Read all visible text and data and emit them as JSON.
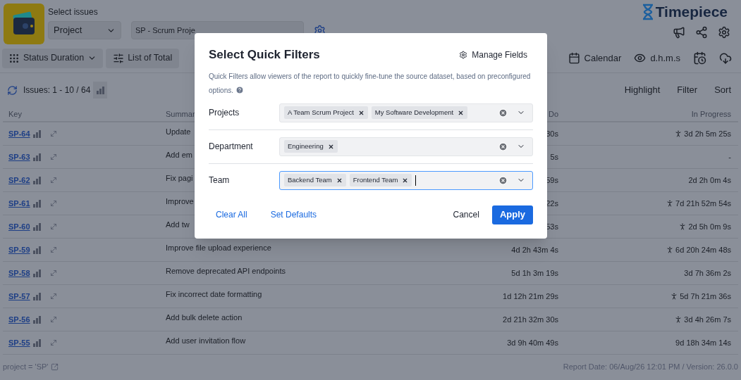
{
  "header": {
    "label": "Select issues",
    "scope_select": "Project",
    "project_select": "SP - Scrum Proje",
    "brand": "Timepiece"
  },
  "toolbar": {
    "left": [
      "Status Duration",
      "List of Total"
    ],
    "right": [
      "Calendar",
      "d.h.m.s"
    ]
  },
  "issues_bar": {
    "count": "Issues: 1 - 10 / 64",
    "actions": [
      "Highlight",
      "Filter",
      "Sort"
    ]
  },
  "table": {
    "columns": [
      "Key",
      "Summar",
      "Do",
      "In Progress"
    ],
    "rows": [
      {
        "key": "SP-64",
        "summary": "Update",
        "to_do": "30s",
        "in_progress": "3d 2h 5m 25s",
        "running": true
      },
      {
        "key": "SP-63",
        "summary": "Add em",
        "to_do": "5s",
        "in_progress": "-",
        "running": false
      },
      {
        "key": "SP-62",
        "summary": "Fix pagi",
        "to_do": "59s",
        "in_progress": "2d 2h 0m 4s",
        "running": false
      },
      {
        "key": "SP-61",
        "summary": "Improve",
        "to_do": "22s",
        "in_progress": "7d 21h 52m 54s",
        "running": true
      },
      {
        "key": "SP-60",
        "summary": "Add tw",
        "to_do": "53s",
        "in_progress": "2d 5h 0m 9s",
        "running": true
      },
      {
        "key": "SP-59",
        "summary": "Improve file upload experience",
        "to_do": "4d 2h 43m 4s",
        "in_progress": "6d 20h 24m 48s",
        "running": true
      },
      {
        "key": "SP-58",
        "summary": "Remove deprecated API endpoints",
        "to_do": "5d 1h 3m 19s",
        "in_progress": "3d 7h 36m 2s",
        "running": false
      },
      {
        "key": "SP-57",
        "summary": "Fix incorrect date formatting",
        "to_do": "1d 12h 21m 29s",
        "in_progress": "5d 7h 21m 36s",
        "running": true
      },
      {
        "key": "SP-56",
        "summary": "Add bulk delete action",
        "to_do": "2d 21h 32m 30s",
        "in_progress": "3d 4h 26m 7s",
        "running": true
      },
      {
        "key": "SP-55",
        "summary": "Add user invitation flow",
        "to_do": "3d 9h 40m 49s",
        "in_progress": "9d 18h 34m 14s",
        "running": false
      }
    ]
  },
  "footer": {
    "query": "project = 'SP'",
    "report": "Report Date: 06/Aug/26 12:01 PM / Version: 26.0.0"
  },
  "dialog": {
    "title": "Select Quick Filters",
    "manage": "Manage Fields",
    "description": "Quick Filters allow viewers of the report to quickly fine-tune the source dataset, based on preconfigured options.",
    "fields": [
      {
        "label": "Projects",
        "tags": [
          "A Team Scrum Project",
          "My Software Development"
        ],
        "focused": false
      },
      {
        "label": "Department",
        "tags": [
          "Engineering"
        ],
        "focused": false
      },
      {
        "label": "Team",
        "tags": [
          "Backend Team",
          "Frontend Team"
        ],
        "focused": true
      }
    ],
    "links": [
      "Clear All",
      "Set Defaults"
    ],
    "cancel": "Cancel",
    "apply": "Apply"
  }
}
